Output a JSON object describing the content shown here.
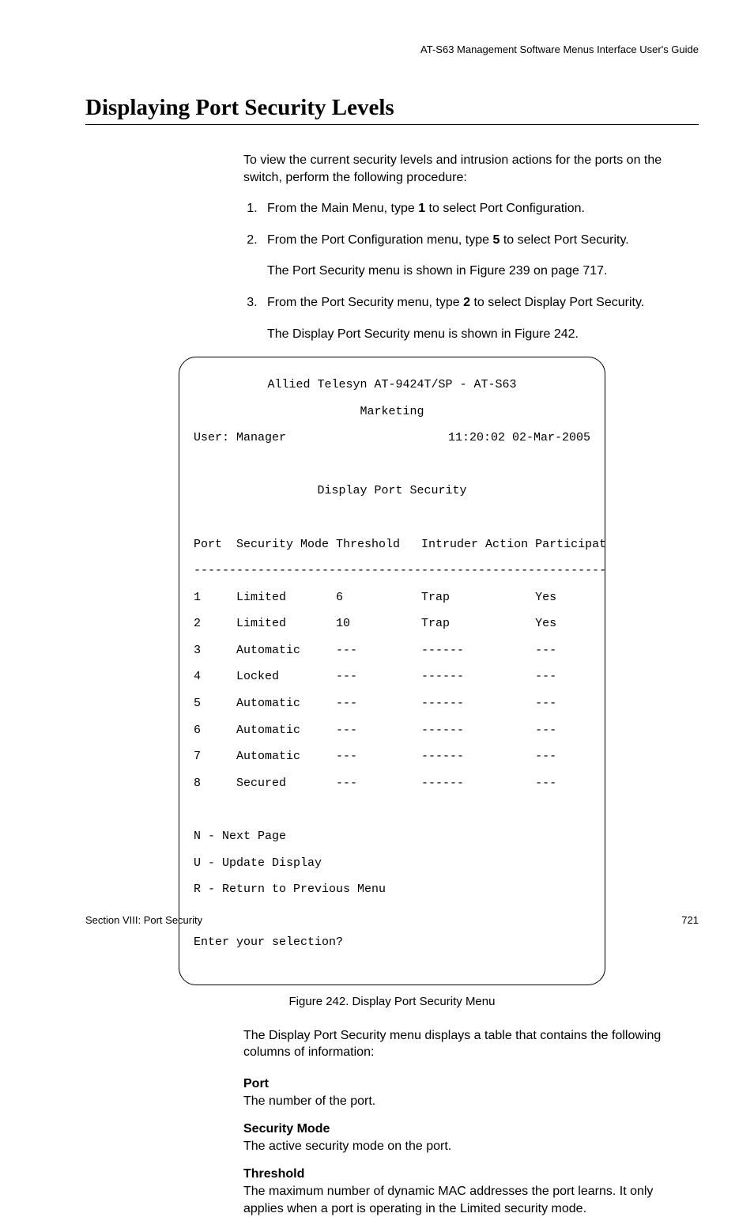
{
  "header": {
    "guide": "AT-S63 Management Software Menus Interface User's Guide"
  },
  "title": "Displaying Port Security Levels",
  "intro": "To view the current security levels and intrusion actions for the ports on the switch, perform the following procedure:",
  "steps": {
    "s1a": "From the Main Menu, type ",
    "s1b": "1",
    "s1c": " to select Port Configuration.",
    "s2a": "From the Port Configuration menu, type ",
    "s2b": "5",
    "s2c": " to select Port Security.",
    "s2sub": "The Port Security menu is shown in Figure 239 on page 717.",
    "s3a": "From the Port Security menu, type ",
    "s3b": "2",
    "s3c": " to select Display Port Security.",
    "s3sub": "The Display Port Security menu is shown in Figure 242."
  },
  "terminal": {
    "line1": "Allied Telesyn AT-9424T/SP - AT-S63",
    "line2": "Marketing",
    "user": "User: Manager",
    "timestamp": "11:20:02 02-Mar-2005",
    "screen_title": "Display Port Security",
    "columns": "Port  Security Mode Threshold   Intruder Action Participating",
    "divider": "----------------------------------------------------------------",
    "rows": [
      "1     Limited       6           Trap            Yes",
      "2     Limited       10          Trap            Yes",
      "3     Automatic     ---         ------          ---",
      "4     Locked        ---         ------          ---",
      "5     Automatic     ---         ------          ---",
      "6     Automatic     ---         ------          ---",
      "7     Automatic     ---         ------          ---",
      "8     Secured       ---         ------          ---"
    ],
    "opt_n": "N - Next Page",
    "opt_u": "U - Update Display",
    "opt_r": "R - Return to Previous Menu",
    "prompt": "Enter your selection?"
  },
  "figure_caption": "Figure 242. Display Port Security Menu",
  "after_figure": "The Display Port Security menu displays a table that contains the following columns of information:",
  "defs": {
    "port_t": "Port",
    "port_d": "The number of the port.",
    "mode_t": "Security Mode",
    "mode_d": "The active security mode on the port.",
    "thr_t": "Threshold",
    "thr_d": "The maximum number of dynamic MAC addresses the port learns. It only applies when a port is operating in the Limited security mode."
  },
  "footer": {
    "section": "Section VIII: Port Security",
    "page": "721"
  },
  "chart_data": {
    "type": "table",
    "title": "Display Port Security",
    "columns": [
      "Port",
      "Security Mode",
      "Threshold",
      "Intruder Action",
      "Participating"
    ],
    "rows": [
      [
        1,
        "Limited",
        6,
        "Trap",
        "Yes"
      ],
      [
        2,
        "Limited",
        10,
        "Trap",
        "Yes"
      ],
      [
        3,
        "Automatic",
        null,
        null,
        null
      ],
      [
        4,
        "Locked",
        null,
        null,
        null
      ],
      [
        5,
        "Automatic",
        null,
        null,
        null
      ],
      [
        6,
        "Automatic",
        null,
        null,
        null
      ],
      [
        7,
        "Automatic",
        null,
        null,
        null
      ],
      [
        8,
        "Secured",
        null,
        null,
        null
      ]
    ]
  }
}
